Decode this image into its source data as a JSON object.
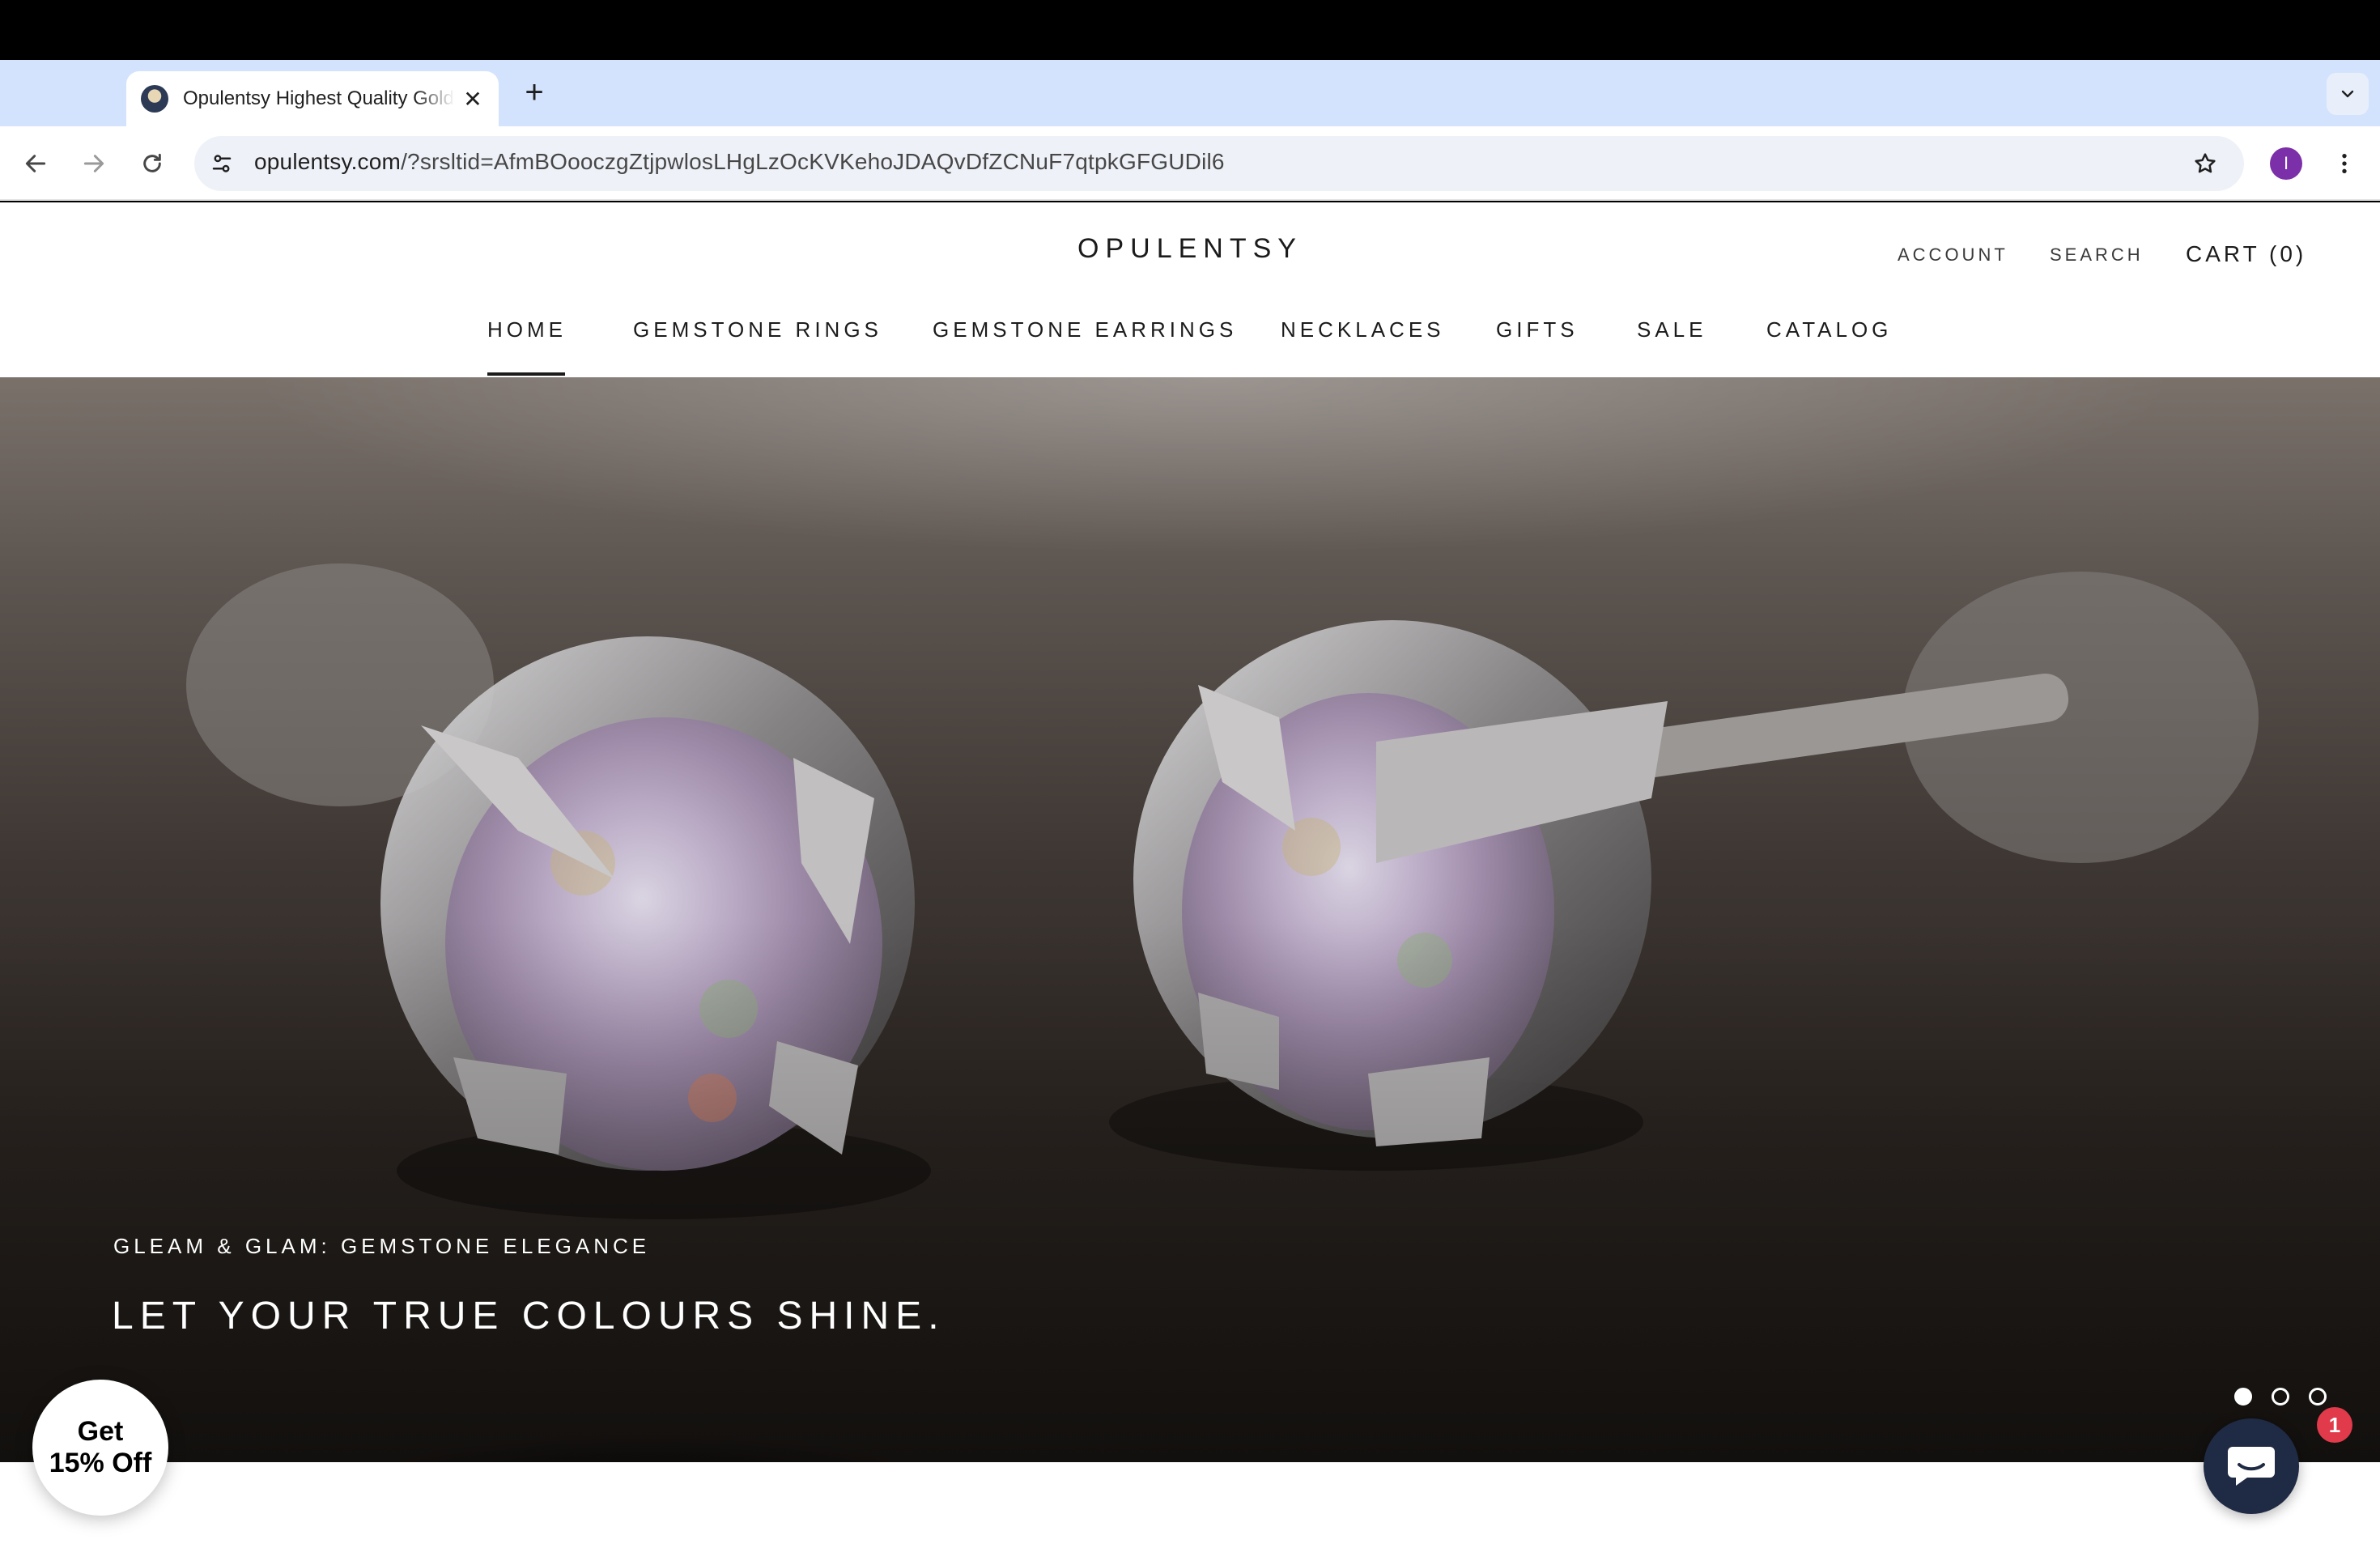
{
  "browser": {
    "tab": {
      "title": "Opulentsy Highest Quality Gold & Gemstone Jewellery",
      "close_glyph": "✕"
    },
    "new_tab_glyph": "+",
    "url": {
      "domain": "opulentsy.com",
      "path": "/?srsltid=AfmBOooczgZtjpwlosLHgLzOcKVKehoJDAQvDfZCNuF7qtpkGFGUDil6"
    },
    "profile_initial": "I",
    "profile_color": "#7b2fa8"
  },
  "header": {
    "logo": "OPULENTSY",
    "account": "ACCOUNT",
    "search": "SEARCH",
    "cart": "CART (0)"
  },
  "nav": {
    "items": [
      {
        "label": "HOME",
        "active": true
      },
      {
        "label": "GEMSTONE RINGS"
      },
      {
        "label": "GEMSTONE EARRINGS"
      },
      {
        "label": "NECKLACES"
      },
      {
        "label": "GIFTS"
      },
      {
        "label": "SALE"
      },
      {
        "label": "CATALOG"
      }
    ]
  },
  "hero": {
    "eyebrow": "GLEAM & GLAM: GEMSTONE ELEGANCE",
    "heading": "LET YOUR TRUE COLOURS SHINE.",
    "slides_total": 3,
    "active_slide": 1
  },
  "promo": {
    "line1": "Get",
    "line2": "15% Off"
  },
  "chat": {
    "badge_count": "1",
    "accent": "#e03a4b"
  }
}
